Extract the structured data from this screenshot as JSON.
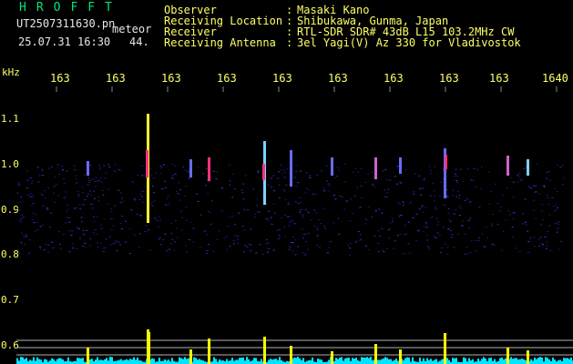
{
  "header": {
    "title": "HROFFT",
    "filename": "UT2507311630.pn",
    "tag": "meteor",
    "datetime": "25.07.31 16:30",
    "count": "44."
  },
  "info": [
    {
      "label": "Observer",
      "colon": ":",
      "value": "Masaki Kano"
    },
    {
      "label": "Receiving Location",
      "colon": ":",
      "value": "Shibukawa, Gunma, Japan"
    },
    {
      "label": "Receiver",
      "colon": ":",
      "value": "RTL-SDR SDR# 43dB L15 103.2MHz CW"
    },
    {
      "label": "Receiving Antenna",
      "colon": ":",
      "value": "3el Yagi(V) Az 330 for Vladivostok"
    }
  ],
  "axis": {
    "unit": "kHz",
    "x_ticks": [
      "163",
      "163",
      "163",
      "163",
      "163",
      "163",
      "163",
      "163",
      "163",
      "1640"
    ],
    "y_ticks": [
      "1.1",
      "1.0",
      "0.9",
      "0.8",
      "0.7",
      "0.6"
    ]
  },
  "colors": {
    "background": "#000000",
    "title": "#00e676",
    "labels": "#ffff66",
    "text": "#e8e8e8",
    "band": "#1a1a7a",
    "echo_hot": "#ff3377",
    "echo_warm": "#ffee33",
    "histogram_line": "#00e5ff",
    "histogram_bar": "#ffff00"
  }
}
